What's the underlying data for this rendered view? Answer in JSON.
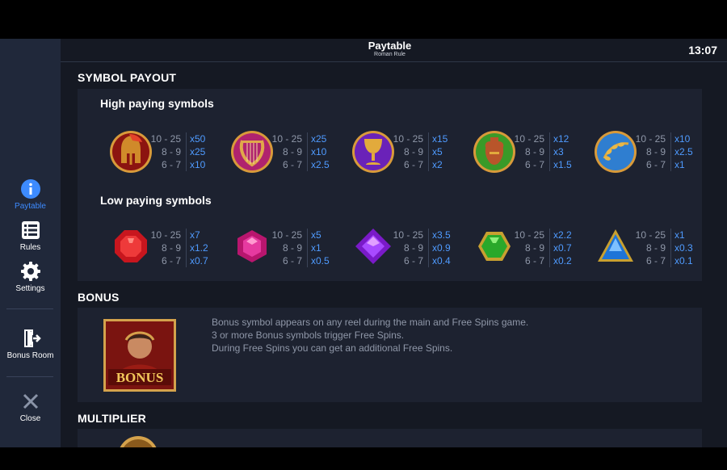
{
  "header": {
    "title": "Paytable",
    "subtitle": "Roman Rule",
    "clock": "13:07"
  },
  "sidebar": {
    "items": [
      {
        "label": "Paytable",
        "icon": "info-icon",
        "active": true
      },
      {
        "label": "Rules",
        "icon": "list-icon",
        "active": false
      },
      {
        "label": "Settings",
        "icon": "gear-icon",
        "active": false
      },
      {
        "label": "Bonus Room",
        "icon": "exit-door-icon",
        "active": false
      },
      {
        "label": "Close",
        "icon": "close-icon",
        "active": false
      }
    ]
  },
  "symbol_payout": {
    "title": "SYMBOL PAYOUT",
    "high_title": "High paying symbols",
    "low_title": "Low paying symbols",
    "high": [
      {
        "icon": "spartan-helmet-icon",
        "counts": [
          "10 - 25",
          "8 - 9",
          "6 - 7"
        ],
        "multipliers": [
          "x50",
          "x25",
          "x10"
        ]
      },
      {
        "icon": "lyre-harp-icon",
        "counts": [
          "10 - 25",
          "8 - 9",
          "6 - 7"
        ],
        "multipliers": [
          "x25",
          "x10",
          "x2.5"
        ]
      },
      {
        "icon": "golden-chalice-icon",
        "counts": [
          "10 - 25",
          "8 - 9",
          "6 - 7"
        ],
        "multipliers": [
          "x15",
          "x5",
          "x2"
        ]
      },
      {
        "icon": "amphora-vase-icon",
        "counts": [
          "10 - 25",
          "8 - 9",
          "6 - 7"
        ],
        "multipliers": [
          "x12",
          "x3",
          "x1.5"
        ]
      },
      {
        "icon": "laurel-wreath-icon",
        "counts": [
          "10 - 25",
          "8 - 9",
          "6 - 7"
        ],
        "multipliers": [
          "x10",
          "x2.5",
          "x1"
        ]
      }
    ],
    "low": [
      {
        "icon": "red-gem-icon",
        "color": "#e5262e",
        "counts": [
          "10 - 25",
          "8 - 9",
          "6 - 7"
        ],
        "multipliers": [
          "x7",
          "x1.2",
          "x0.7"
        ]
      },
      {
        "icon": "pink-gem-icon",
        "color": "#e0369a",
        "counts": [
          "10 - 25",
          "8 - 9",
          "6 - 7"
        ],
        "multipliers": [
          "x5",
          "x1",
          "x0.5"
        ]
      },
      {
        "icon": "purple-gem-icon",
        "color": "#9a34e8",
        "counts": [
          "10 - 25",
          "8 - 9",
          "6 - 7"
        ],
        "multipliers": [
          "x3.5",
          "x0.9",
          "x0.4"
        ]
      },
      {
        "icon": "green-gem-icon",
        "color": "#38c828",
        "counts": [
          "10 - 25",
          "8 - 9",
          "6 - 7"
        ],
        "multipliers": [
          "x2.2",
          "x0.7",
          "x0.2"
        ]
      },
      {
        "icon": "blue-triangle-gem-icon",
        "color": "#2f8fe6",
        "counts": [
          "10 - 25",
          "8 - 9",
          "6 - 7"
        ],
        "multipliers": [
          "x1",
          "x0.3",
          "x0.1"
        ]
      }
    ]
  },
  "bonus": {
    "title": "BONUS",
    "symbol_label": "BONUS",
    "lines": [
      "Bonus symbol appears on any reel during the main and Free Spins game.",
      "3 or more Bonus symbols trigger Free Spins.",
      "During Free Spins you can get an additional Free Spins."
    ]
  },
  "multiplier": {
    "title": "MULTIPLIER"
  },
  "colors": {
    "accent": "#3d8bff",
    "multiplier": "#4f9bff",
    "muted_text": "#8f97a8",
    "gold": "#d4a24c"
  }
}
